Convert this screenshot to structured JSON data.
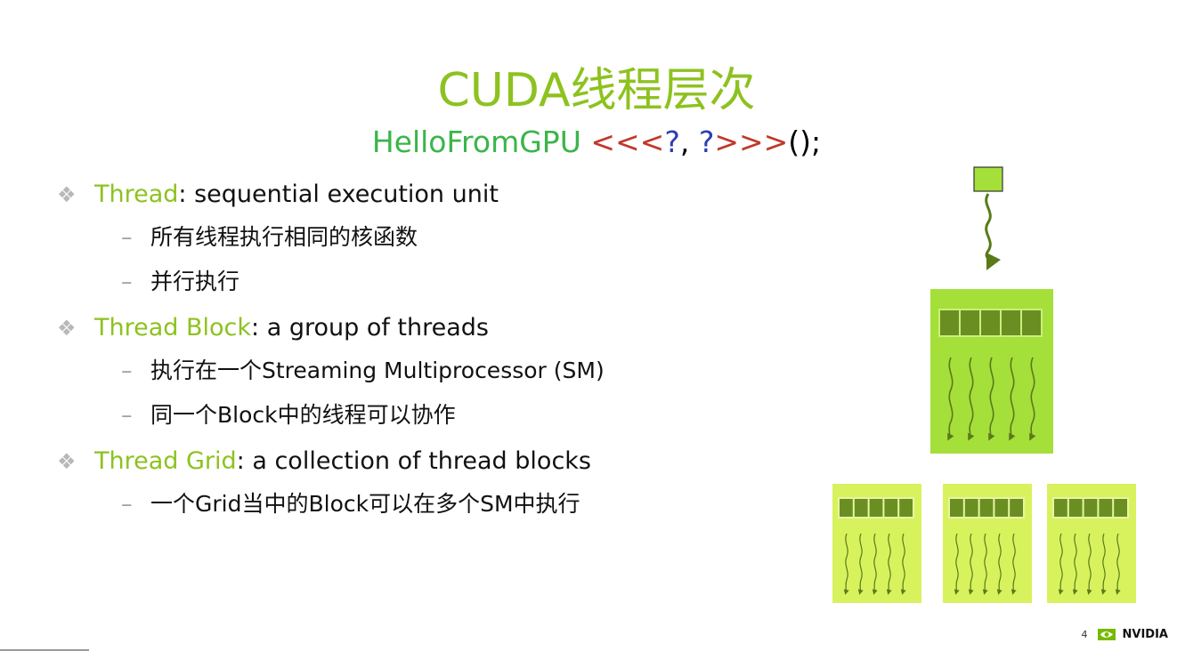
{
  "slide": {
    "title": "CUDA线程层次",
    "code": {
      "fn": "HelloFromGPU",
      "open": "<<<",
      "arg1": "?",
      "comma": ", ",
      "arg2": "?",
      "close": ">>>",
      "tail": "();"
    },
    "bullet_mark": "❖",
    "sub_mark": "–",
    "items": [
      {
        "term": "Thread",
        "desc": ": sequential execution unit",
        "subs": [
          "所有线程执行相同的核函数",
          "并行执行"
        ]
      },
      {
        "term": "Thread Block",
        "desc": ": a group of threads",
        "subs": [
          "执行在一个Streaming Multiprocessor (SM)",
          "同一个Block中的线程可以协作"
        ]
      },
      {
        "term": "Thread Grid",
        "desc": ": a collection of thread blocks",
        "subs": [
          "一个Grid当中的Block可以在多个SM中执行"
        ]
      }
    ]
  },
  "footer": {
    "page_number": "4",
    "brand": "NVIDIA"
  },
  "colors": {
    "accent": "#8dc21f",
    "code_fn": "#3bb54a",
    "code_angle": "#c0392b",
    "code_arg": "#2c3fb0",
    "block_fill": "#a5df3a",
    "grid_block_fill": "#d8f25e",
    "thread_cell": "#6b8e23",
    "arrow": "#5a7a1a"
  }
}
